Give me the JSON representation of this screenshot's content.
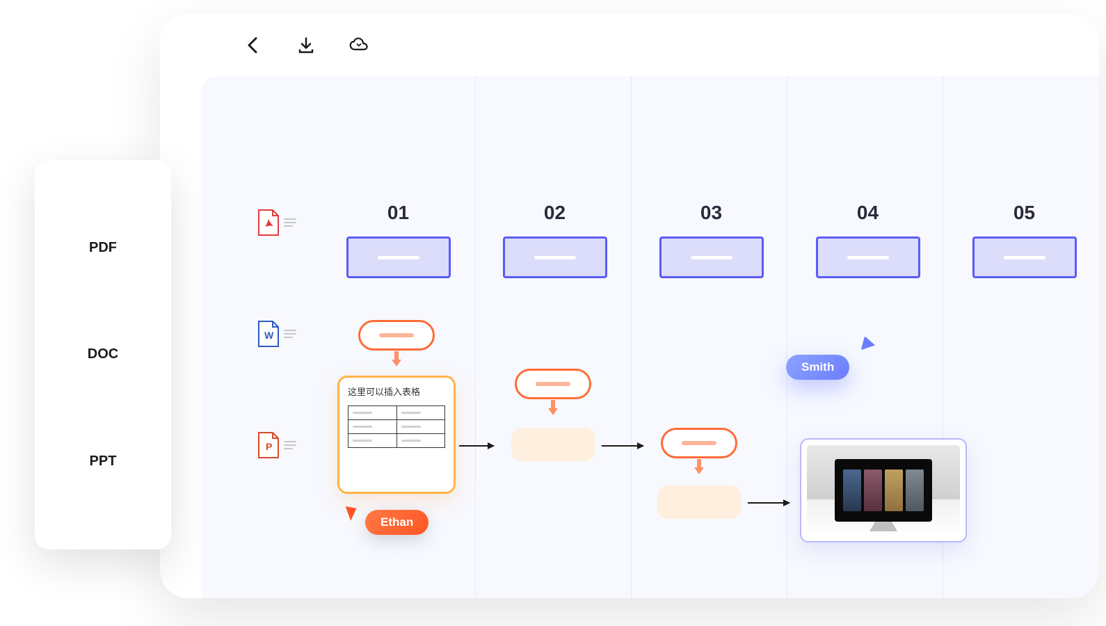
{
  "sidebar": {
    "items": [
      {
        "label": "PDF"
      },
      {
        "label": "DOC"
      },
      {
        "label": "PPT"
      }
    ]
  },
  "toolbar": {
    "back_icon": "back-arrow",
    "download_icon": "download",
    "cloud_icon": "cloud-sync"
  },
  "file_icons": [
    {
      "type": "pdf",
      "color": "#e13c3c",
      "letter": "A"
    },
    {
      "type": "doc",
      "color": "#2b5bbf",
      "letter": "W"
    },
    {
      "type": "ppt",
      "color": "#d64b2a",
      "letter": "P"
    }
  ],
  "columns": [
    {
      "number": "01"
    },
    {
      "number": "02"
    },
    {
      "number": "03"
    },
    {
      "number": "04"
    },
    {
      "number": "05"
    }
  ],
  "table_card": {
    "text": "这里可以插入表格"
  },
  "users": {
    "ethan": "Ethan",
    "smith": "Smith"
  },
  "colors": {
    "primary_blue": "#5b5bf5",
    "accent_orange": "#ff6b35",
    "badge_orange": "#ff5522",
    "badge_blue": "#6b7dff",
    "canvas_bg": "#f7f9ff"
  }
}
